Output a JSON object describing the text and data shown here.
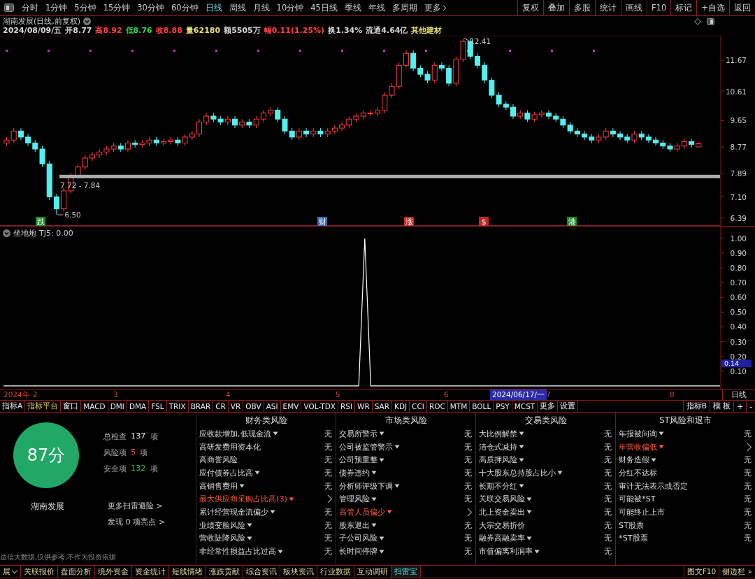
{
  "period_tabs": [
    {
      "label": "分时",
      "selected": false
    },
    {
      "label": "1分钟",
      "selected": false
    },
    {
      "label": "5分钟",
      "selected": false
    },
    {
      "label": "15分钟",
      "selected": false
    },
    {
      "label": "30分钟",
      "selected": false
    },
    {
      "label": "60分钟",
      "selected": false
    },
    {
      "label": "日线",
      "selected": true
    },
    {
      "label": "周线",
      "selected": false
    },
    {
      "label": "月线",
      "selected": false
    },
    {
      "label": "10分钟",
      "selected": false
    },
    {
      "label": "45日线",
      "selected": false
    },
    {
      "label": "季线",
      "selected": false
    },
    {
      "label": "年线",
      "selected": false
    },
    {
      "label": "多周期",
      "selected": false
    },
    {
      "label": "更多",
      "selected": false
    }
  ],
  "tool_buttons": [
    "复权",
    "叠加",
    "多股",
    "统计",
    "画线",
    "F10",
    "标记",
    "+自选",
    "返回"
  ],
  "chart": {
    "title": "湖南发展(日线,前复权)",
    "quote": [
      {
        "text": "2024/08/09/五",
        "color": "#d8d8d8"
      },
      {
        "text": "开8.77",
        "color": "#d8d8d8"
      },
      {
        "text": "高8.92",
        "color": "#ff4040"
      },
      {
        "text": "低8.76",
        "color": "#30d050"
      },
      {
        "text": "收8.88",
        "color": "#ff4040"
      },
      {
        "text": "量62180",
        "color": "#e8e070"
      },
      {
        "text": "额5505万",
        "color": "#d8d8d8"
      },
      {
        "text": "幅0.11(1.25%)",
        "color": "#ff4040"
      },
      {
        "text": "换1.34%",
        "color": "#d8d8d8"
      },
      {
        "text": "流通4.64亿",
        "color": "#d8d8d8"
      },
      {
        "text": "其他建材",
        "color": "#e8e070"
      }
    ],
    "high_label": "12.41",
    "low_label": "6.50",
    "band_label": "7.72 - 7.84",
    "event_markers": [
      {
        "label": "跌",
        "color": "#1f8a2a"
      },
      {
        "label": "财",
        "color": "#3a6ab0"
      },
      {
        "label": "涨",
        "color": "#c02828"
      },
      {
        "label": "$",
        "color": "#c02828"
      },
      {
        "label": "港",
        "color": "#1f8a2a"
      }
    ],
    "chart_data": {
      "type": "candlestick",
      "ylim": [
        6.13,
        12.49
      ],
      "yticks": [
        {
          "value": 11.67,
          "label": "11.67"
        },
        {
          "value": 10.61,
          "label": "10.61"
        },
        {
          "value": 9.65,
          "label": "9.65"
        },
        {
          "value": 8.77,
          "label": "8.77"
        },
        {
          "value": 7.89,
          "label": "7.89"
        },
        {
          "value": 7.1,
          "label": "7.10"
        },
        {
          "value": 6.39,
          "label": "6.39"
        }
      ],
      "ohlc": [
        [
          8.9,
          9.1,
          8.8,
          9.0
        ],
        [
          9.0,
          9.4,
          8.9,
          9.3
        ],
        [
          9.3,
          9.4,
          9.0,
          9.1
        ],
        [
          9.1,
          9.2,
          8.8,
          8.9
        ],
        [
          8.9,
          9.0,
          8.6,
          8.7
        ],
        [
          8.7,
          8.8,
          8.1,
          8.2
        ],
        [
          8.2,
          8.3,
          7.0,
          7.1
        ],
        [
          7.1,
          7.2,
          6.5,
          6.7
        ],
        [
          6.7,
          7.4,
          6.6,
          7.3
        ],
        [
          7.3,
          7.9,
          7.2,
          7.8
        ],
        [
          7.8,
          8.2,
          7.7,
          8.1
        ],
        [
          8.1,
          8.5,
          8.0,
          8.4
        ],
        [
          8.4,
          8.6,
          8.3,
          8.5
        ],
        [
          8.5,
          8.7,
          8.4,
          8.6
        ],
        [
          8.6,
          8.8,
          8.5,
          8.7
        ],
        [
          8.7,
          8.9,
          8.6,
          8.8
        ],
        [
          8.8,
          8.9,
          8.6,
          8.7
        ],
        [
          8.7,
          9.0,
          8.6,
          8.9
        ],
        [
          8.9,
          9.0,
          8.75,
          8.85
        ],
        [
          8.85,
          9.0,
          8.75,
          8.9
        ],
        [
          8.9,
          9.1,
          8.8,
          9.0
        ],
        [
          9.0,
          9.1,
          8.8,
          8.9
        ],
        [
          8.9,
          9.05,
          8.8,
          8.95
        ],
        [
          8.95,
          9.1,
          8.85,
          9.0
        ],
        [
          9.0,
          9.1,
          8.8,
          8.9
        ],
        [
          8.9,
          9.2,
          8.8,
          9.1
        ],
        [
          9.1,
          9.3,
          9.0,
          9.2
        ],
        [
          9.2,
          9.7,
          9.1,
          9.6
        ],
        [
          9.6,
          9.9,
          9.5,
          9.8
        ],
        [
          9.8,
          9.9,
          9.6,
          9.7
        ],
        [
          9.7,
          9.8,
          9.5,
          9.6
        ],
        [
          9.6,
          9.8,
          9.5,
          9.7
        ],
        [
          9.7,
          9.8,
          9.4,
          9.5
        ],
        [
          9.5,
          9.7,
          9.4,
          9.6
        ],
        [
          9.6,
          9.7,
          9.4,
          9.5
        ],
        [
          9.5,
          9.8,
          9.4,
          9.7
        ],
        [
          9.7,
          10.0,
          9.6,
          9.9
        ],
        [
          9.9,
          10.1,
          9.8,
          10.0
        ],
        [
          10.0,
          10.1,
          9.6,
          9.7
        ],
        [
          9.7,
          9.8,
          9.2,
          9.3
        ],
        [
          9.3,
          9.4,
          9.0,
          9.1
        ],
        [
          9.1,
          9.4,
          9.0,
          9.3
        ],
        [
          9.3,
          9.4,
          9.1,
          9.2
        ],
        [
          9.2,
          9.4,
          9.1,
          9.3
        ],
        [
          9.3,
          9.4,
          9.1,
          9.2
        ],
        [
          9.2,
          9.4,
          9.1,
          9.3
        ],
        [
          9.3,
          9.5,
          9.2,
          9.4
        ],
        [
          9.4,
          9.6,
          9.3,
          9.5
        ],
        [
          9.5,
          9.8,
          9.4,
          9.7
        ],
        [
          9.7,
          9.9,
          9.6,
          9.8
        ],
        [
          9.8,
          10.0,
          9.7,
          9.9
        ],
        [
          9.9,
          10.0,
          9.8,
          9.9
        ],
        [
          9.9,
          10.1,
          9.8,
          10.0
        ],
        [
          10.0,
          10.6,
          9.9,
          10.5
        ],
        [
          10.5,
          10.9,
          10.4,
          10.8
        ],
        [
          10.8,
          11.6,
          10.7,
          11.5
        ],
        [
          11.5,
          12.0,
          11.4,
          11.9
        ],
        [
          11.9,
          12.0,
          11.3,
          11.4
        ],
        [
          11.4,
          11.5,
          11.1,
          11.2
        ],
        [
          11.2,
          11.3,
          10.9,
          11.0
        ],
        [
          11.0,
          11.6,
          10.9,
          11.5
        ],
        [
          11.5,
          11.6,
          11.3,
          11.4
        ],
        [
          11.4,
          11.5,
          10.8,
          10.9
        ],
        [
          10.9,
          11.8,
          10.8,
          11.7
        ],
        [
          11.7,
          12.41,
          11.6,
          12.3
        ],
        [
          12.3,
          12.4,
          11.7,
          11.8
        ],
        [
          11.8,
          11.9,
          11.4,
          11.5
        ],
        [
          11.5,
          11.6,
          10.9,
          11.0
        ],
        [
          11.0,
          11.1,
          10.4,
          10.5
        ],
        [
          10.5,
          10.6,
          10.1,
          10.2
        ],
        [
          10.2,
          10.3,
          10.0,
          10.1
        ],
        [
          10.1,
          10.2,
          9.7,
          9.8
        ],
        [
          9.8,
          10.0,
          9.7,
          9.9
        ],
        [
          9.9,
          10.0,
          9.6,
          9.7
        ],
        [
          9.7,
          9.95,
          9.6,
          9.85
        ],
        [
          9.85,
          10.0,
          9.75,
          9.9
        ],
        [
          9.9,
          10.0,
          9.7,
          9.8
        ],
        [
          9.8,
          9.9,
          9.6,
          9.7
        ],
        [
          9.7,
          9.8,
          9.4,
          9.5
        ],
        [
          9.5,
          9.6,
          9.2,
          9.3
        ],
        [
          9.3,
          9.4,
          9.1,
          9.2
        ],
        [
          9.2,
          9.3,
          9.0,
          9.1
        ],
        [
          9.1,
          9.2,
          8.9,
          9.0
        ],
        [
          9.0,
          9.2,
          8.9,
          9.1
        ],
        [
          9.1,
          9.4,
          9.0,
          9.3
        ],
        [
          9.3,
          9.4,
          9.1,
          9.2
        ],
        [
          9.2,
          9.3,
          9.0,
          9.1
        ],
        [
          9.1,
          9.2,
          8.9,
          9.0
        ],
        [
          9.0,
          9.3,
          8.9,
          9.2
        ],
        [
          9.2,
          9.3,
          9.0,
          9.1
        ],
        [
          9.1,
          9.2,
          8.9,
          9.0
        ],
        [
          9.0,
          9.1,
          8.8,
          8.9
        ],
        [
          8.9,
          9.0,
          8.7,
          8.8
        ],
        [
          8.8,
          8.9,
          8.6,
          8.7
        ],
        [
          8.7,
          8.9,
          8.6,
          8.8
        ],
        [
          8.8,
          9.05,
          8.7,
          8.95
        ],
        [
          8.95,
          9.05,
          8.75,
          8.85
        ],
        [
          8.77,
          8.92,
          8.76,
          8.88
        ]
      ]
    }
  },
  "indicator": {
    "name": "坐地炮",
    "reading": "TJ5: 0.00",
    "current_value": "0.14",
    "chart_data": {
      "type": "line",
      "ylim": [
        -0.02,
        1.08
      ],
      "yticks": [
        {
          "value": 0.1,
          "label": "0.10"
        },
        {
          "value": 0.2,
          "label": "0.20"
        },
        {
          "value": 0.3,
          "label": "0.30"
        },
        {
          "value": 0.4,
          "label": "0.40"
        },
        {
          "value": 0.5,
          "label": "0.50"
        },
        {
          "value": 0.6,
          "label": "0.60"
        },
        {
          "value": 0.7,
          "label": "0.70"
        },
        {
          "value": 0.8,
          "label": "0.80"
        },
        {
          "value": 0.9,
          "label": "0.90"
        },
        {
          "value": 1.0,
          "label": "1.00"
        }
      ],
      "series": [
        {
          "color": "#ffffff",
          "values": [
            0,
            0,
            0,
            0,
            0,
            0,
            0,
            0,
            0,
            0,
            0,
            0,
            0,
            0,
            0,
            0,
            0,
            0,
            0,
            0,
            0,
            0,
            0,
            0,
            0,
            0,
            0,
            0,
            0,
            0,
            0,
            0,
            0,
            0,
            0,
            0,
            0,
            0,
            0,
            0,
            0,
            0,
            0,
            0,
            0,
            0,
            0,
            0,
            0,
            0,
            0,
            0,
            0,
            0,
            0,
            0,
            0,
            0,
            0,
            0,
            1,
            0,
            0,
            0,
            0,
            0,
            0,
            0,
            0,
            0,
            0,
            0,
            0,
            0,
            0,
            0,
            0,
            0,
            0,
            0,
            0,
            0,
            0,
            0,
            0,
            0,
            0,
            0,
            0,
            0,
            0,
            0,
            0,
            0,
            0,
            0,
            0,
            0,
            0,
            0,
            0,
            0,
            0,
            0,
            0,
            0,
            0,
            0,
            0,
            0,
            0,
            0,
            0,
            0,
            0,
            0,
            0,
            0,
            0,
            0
          ]
        }
      ]
    }
  },
  "date_axis": {
    "year": "2024年",
    "months": [
      "2",
      "3",
      "4",
      "5",
      "6",
      "7",
      "8"
    ],
    "cursor_date": "2024/06/17/一",
    "period": "日线"
  },
  "indicator_tabs": [
    {
      "label": "指标A",
      "selected": false
    },
    {
      "label": "指标平台",
      "selected": true
    },
    {
      "label": "窗口",
      "selected": false
    },
    {
      "label": "MACD",
      "selected": false
    },
    {
      "label": "DMI",
      "selected": false
    },
    {
      "label": "DMA",
      "selected": false
    },
    {
      "label": "FSL",
      "selected": false
    },
    {
      "label": "TRIX",
      "selected": false
    },
    {
      "label": "BRAR",
      "selected": false
    },
    {
      "label": "CR",
      "selected": false
    },
    {
      "label": "VR",
      "selected": false
    },
    {
      "label": "OBV",
      "selected": false
    },
    {
      "label": "ASI",
      "selected": false
    },
    {
      "label": "EMV",
      "selected": false
    },
    {
      "label": "VOL-TDX",
      "selected": false
    },
    {
      "label": "RSI",
      "selected": false
    },
    {
      "label": "WR",
      "selected": false
    },
    {
      "label": "SAR",
      "selected": false
    },
    {
      "label": "KDJ",
      "selected": false
    },
    {
      "label": "CCI",
      "selected": false
    },
    {
      "label": "ROC",
      "selected": false
    },
    {
      "label": "MTM",
      "selected": false
    },
    {
      "label": "BOLL",
      "selected": false
    },
    {
      "label": "PSY",
      "selected": false
    },
    {
      "label": "MCST",
      "selected": false
    },
    {
      "label": "更多",
      "selected": false
    },
    {
      "label": "设置",
      "selected": false
    }
  ],
  "indicator_tools": [
    "指标B",
    "模 板",
    "+",
    "-"
  ],
  "scan": {
    "score": "87分",
    "stock": "湖南发展",
    "stats": [
      {
        "label": "总检查",
        "count": "137",
        "unit": "项",
        "color": "#e8e8e8"
      },
      {
        "label": "风险项",
        "count": "5",
        "unit": "项",
        "color": "#ff5a3c"
      },
      {
        "label": "安全项",
        "count": "132",
        "unit": "项",
        "color": "#30c060"
      }
    ],
    "more_link": "更多扫雷避险 >",
    "highlights_link": "发现 0 项亮点 >",
    "disclaimer": "达信大数据,仅供参考,不作为投资依据",
    "categories": [
      {
        "title": "财务类风险",
        "items": [
          {
            "label": "应收款增加,低现金流",
            "dropdown": true,
            "risk": false,
            "status": "无"
          },
          {
            "label": "高研发费用资本化",
            "dropdown": false,
            "risk": false,
            "status": "无"
          },
          {
            "label": "高商誉风险",
            "dropdown": false,
            "risk": false,
            "status": "无"
          },
          {
            "label": "应付债券占比高",
            "dropdown": true,
            "risk": false,
            "status": "无"
          },
          {
            "label": "高销售费用",
            "dropdown": true,
            "risk": false,
            "status": "无"
          },
          {
            "label": "最大供应商采购占比高(3)",
            "dropdown": true,
            "risk": true
          },
          {
            "label": "累计经营现金流偏少",
            "dropdown": true,
            "risk": false,
            "status": "无"
          },
          {
            "label": "业绩变脸风险",
            "dropdown": true,
            "risk": false,
            "status": "无"
          },
          {
            "label": "营收陡降风险",
            "dropdown": true,
            "risk": false,
            "status": "无"
          },
          {
            "label": "非经常性损益占比过高",
            "dropdown": true,
            "risk": false,
            "status": "无"
          }
        ]
      },
      {
        "title": "市场类风险",
        "items": [
          {
            "label": "交易所警示",
            "dropdown": true,
            "risk": false,
            "status": "无"
          },
          {
            "label": "公司被监管警示",
            "dropdown": true,
            "risk": false,
            "status": "无"
          },
          {
            "label": "公司预重整",
            "dropdown": true,
            "risk": false,
            "status": "无"
          },
          {
            "label": "债券违约",
            "dropdown": true,
            "risk": false,
            "status": "无"
          },
          {
            "label": "分析师评级下调",
            "dropdown": true,
            "risk": false,
            "status": "无"
          },
          {
            "label": "管理风险",
            "dropdown": true,
            "risk": false,
            "status": "无"
          },
          {
            "label": "高管人员偏少",
            "dropdown": true,
            "risk": true
          },
          {
            "label": "股东退出",
            "dropdown": true,
            "risk": false,
            "status": "无"
          },
          {
            "label": "子公司风险",
            "dropdown": true,
            "risk": false,
            "status": "无"
          },
          {
            "label": "长时间停牌",
            "dropdown": true,
            "risk": false,
            "status": "无"
          }
        ]
      },
      {
        "title": "交易类风险",
        "items": [
          {
            "label": "大比例解禁",
            "dropdown": true,
            "risk": false,
            "status": "无"
          },
          {
            "label": "清仓式减持",
            "dropdown": true,
            "risk": false,
            "status": "无"
          },
          {
            "label": "高质押风险",
            "dropdown": true,
            "risk": false,
            "status": "无"
          },
          {
            "label": "十大股东总持股占比小",
            "dropdown": true,
            "risk": false,
            "status": "无"
          },
          {
            "label": "长期不分红",
            "dropdown": true,
            "risk": false,
            "status": "无"
          },
          {
            "label": "关联交易风险",
            "dropdown": true,
            "risk": false,
            "status": "无"
          },
          {
            "label": "北上资金卖出",
            "dropdown": true,
            "risk": false,
            "status": "无"
          },
          {
            "label": "大宗交易折价",
            "dropdown": false,
            "risk": false,
            "status": "无"
          },
          {
            "label": "融券高融卖率",
            "dropdown": true,
            "risk": false,
            "status": "无"
          },
          {
            "label": "市值偏离利润率",
            "dropdown": true,
            "risk": false,
            "status": "无"
          }
        ]
      },
      {
        "title": "ST风险和退市",
        "items": [
          {
            "label": "年报被问询",
            "dropdown": true,
            "risk": false,
            "status": "无"
          },
          {
            "label": "年营收偏低",
            "dropdown": true,
            "risk": true
          },
          {
            "label": "财务造假",
            "dropdown": true,
            "risk": false,
            "status": "无"
          },
          {
            "label": "分红不达标",
            "dropdown": false,
            "risk": false,
            "status": "无"
          },
          {
            "label": "审计无法表示或否定",
            "dropdown": false,
            "risk": false,
            "status": "无"
          },
          {
            "label": "可能被*ST",
            "dropdown": false,
            "risk": false,
            "status": "无"
          },
          {
            "label": "可能终止上市",
            "dropdown": false,
            "risk": false,
            "status": "无"
          },
          {
            "label": "ST股票",
            "dropdown": false,
            "risk": false,
            "status": "无"
          },
          {
            "label": "*ST股票",
            "dropdown": false,
            "risk": false,
            "status": "无"
          }
        ]
      }
    ]
  },
  "bottom_tabs": [
    {
      "label": "展",
      "selected": false
    },
    {
      "label": "关联报价",
      "selected": false
    },
    {
      "label": "盘面分析",
      "selected": false
    },
    {
      "label": "境外资金",
      "selected": false
    },
    {
      "label": "资金统计",
      "selected": false
    },
    {
      "label": "短线情绪",
      "selected": false
    },
    {
      "label": "涨跌贡献",
      "selected": false
    },
    {
      "label": "综合资讯",
      "selected": false
    },
    {
      "label": "板块资讯",
      "selected": false
    },
    {
      "label": "行业数据",
      "selected": false
    },
    {
      "label": "互动调研",
      "selected": false
    },
    {
      "label": "扫雷宝",
      "selected": true
    }
  ],
  "bottom_tools": [
    "图文F10",
    "侧边栏 »"
  ]
}
